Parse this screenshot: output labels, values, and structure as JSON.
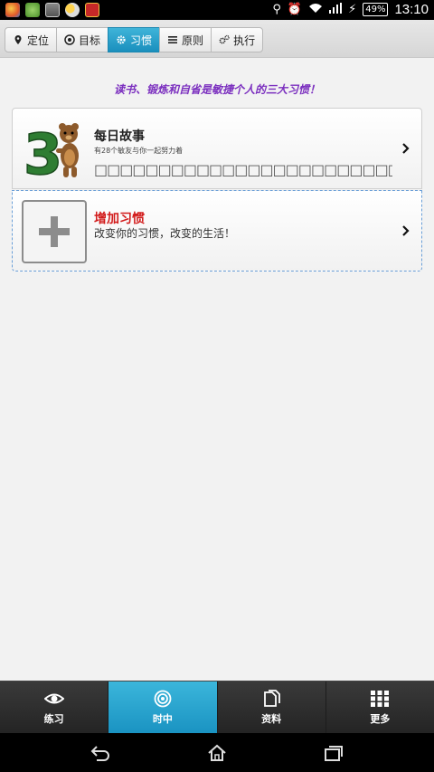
{
  "status_bar": {
    "battery": "49%",
    "time": "13:10"
  },
  "top_tabs": [
    {
      "label": "定位",
      "icon": "location-pin-icon",
      "active": false
    },
    {
      "label": "目标",
      "icon": "target-icon",
      "active": false
    },
    {
      "label": "习惯",
      "icon": "gear-icon",
      "active": true
    },
    {
      "label": "原则",
      "icon": "list-icon",
      "active": false
    },
    {
      "label": "执行",
      "icon": "gears-icon",
      "active": false
    }
  ],
  "slogan": "读书、锻炼和自省是敏捷个人的三大习惯！",
  "habits": [
    {
      "title": "每日故事",
      "subtitle": "有28个敏友与你一起努力着",
      "desc": "□□□□□□□□□□□□□□□□□□□□□□□□□□□□□□□□□□□□□□□□□"
    }
  ],
  "add_habit": {
    "title": "增加习惯",
    "desc": "改变你的习惯，改变的生活！"
  },
  "bottom_nav": [
    {
      "label": "练习",
      "icon": "eye-icon",
      "active": false
    },
    {
      "label": "时中",
      "icon": "target-rings-icon",
      "active": true
    },
    {
      "label": "资料",
      "icon": "documents-icon",
      "active": false
    },
    {
      "label": "更多",
      "icon": "grid-icon",
      "active": false
    }
  ],
  "colors": {
    "accent": "#2aa4cf",
    "slogan": "#7b2fbf",
    "add_title": "#d21b1b"
  }
}
